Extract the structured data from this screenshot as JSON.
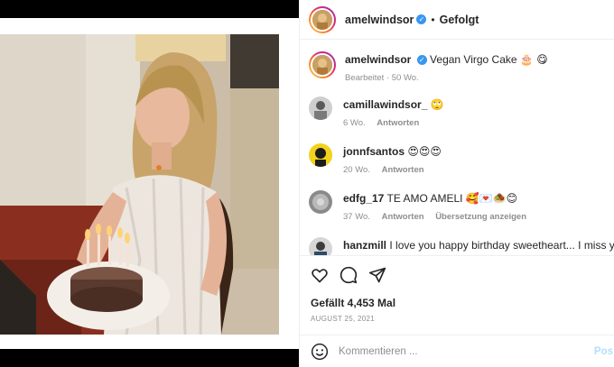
{
  "post": {
    "username": "amelwindsor",
    "follow_state": "Gefolgt",
    "caption": "Vegan Virgo Cake 🎂",
    "caption_emoji": "😋",
    "edited_label": "Bearbeitet",
    "edited_age": "50 Wo."
  },
  "comments": [
    {
      "username": "camillawindsor_",
      "text": "🙄",
      "age": "6 Wo.",
      "reply": "Antworten",
      "translate": ""
    },
    {
      "username": "jonnfsantos",
      "text": "😍😍😍",
      "age": "20 Wo.",
      "reply": "Antworten",
      "translate": ""
    },
    {
      "username": "edfg_17",
      "text": "TE AMO AMELI 🥰💌🧆😊",
      "age": "37 Wo.",
      "reply": "Antworten",
      "translate": "Übersetzung anzeigen"
    },
    {
      "username": "hanzmill",
      "text": "I love you happy birthday sweetheart... I miss you",
      "age": "",
      "reply": "",
      "translate": ""
    }
  ],
  "stats": {
    "likes": "Gefällt 4,453 Mal",
    "date": "AUGUST 25, 2021"
  },
  "composer": {
    "placeholder": "Kommentieren ...",
    "post_label": "Pos"
  },
  "icons": {
    "like": "heart-icon",
    "comment": "comment-icon",
    "share": "share-icon",
    "emoji": "emoji-icon",
    "verified": "verified-badge-icon"
  },
  "colors": {
    "verified": "#3897f0",
    "muted": "#8e8e8e",
    "post_button": "#b2dffc"
  }
}
